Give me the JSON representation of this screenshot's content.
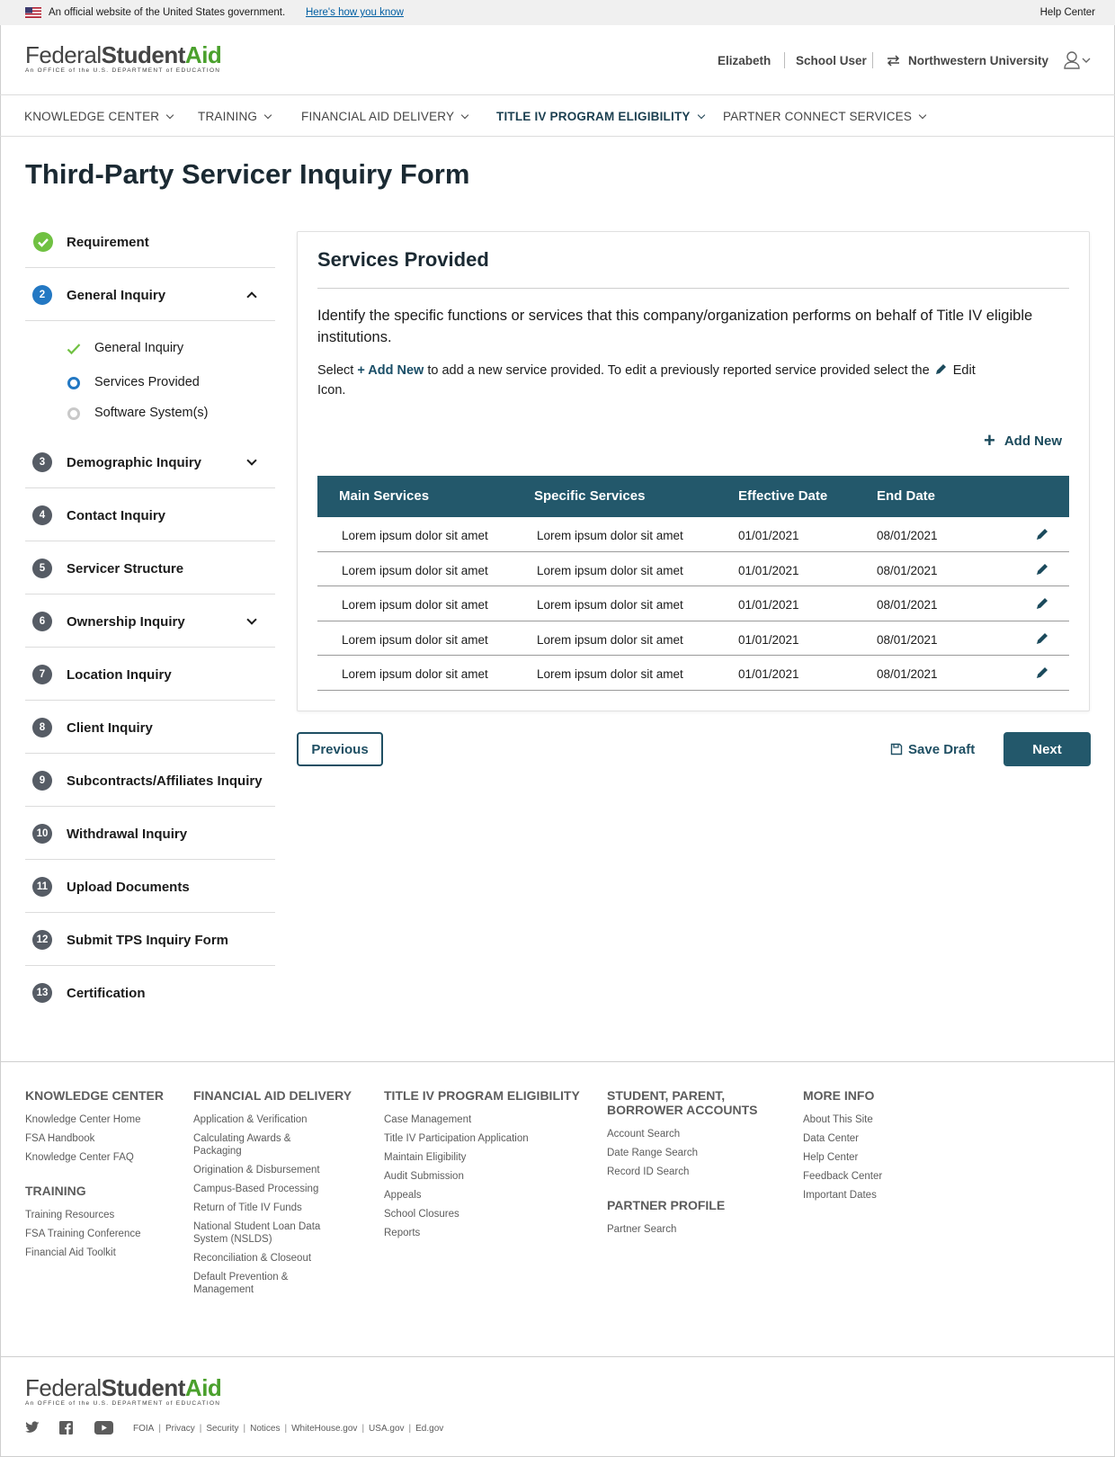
{
  "gov_banner": {
    "official_text": "An official website of the United States government.",
    "how_link": "Here's how you know",
    "help_center": "Help Center"
  },
  "header": {
    "logo": {
      "federal": "Federal",
      "student": "Student",
      "aid": "Aid",
      "tagline": "An OFFICE of the U.S. DEPARTMENT of EDUCATION"
    },
    "user_name": "Elizabeth",
    "role": "School User",
    "institution": "Northwestern University"
  },
  "nav": {
    "items": [
      {
        "label": "KNOWLEDGE CENTER"
      },
      {
        "label": "TRAINING"
      },
      {
        "label": "FINANCIAL AID DELIVERY"
      },
      {
        "label": "TITLE IV PROGRAM ELIGIBILITY"
      },
      {
        "label": "PARTNER CONNECT SERVICES"
      }
    ]
  },
  "page_title": "Third-Party Servicer Inquiry Form",
  "steps": [
    {
      "num": "",
      "label": "Requirement",
      "state": "done"
    },
    {
      "num": "2",
      "label": "General Inquiry",
      "state": "current"
    },
    {
      "num": "3",
      "label": "Demographic Inquiry",
      "state": "todo"
    },
    {
      "num": "4",
      "label": "Contact Inquiry",
      "state": "todo"
    },
    {
      "num": "5",
      "label": "Servicer Structure",
      "state": "todo"
    },
    {
      "num": "6",
      "label": "Ownership Inquiry",
      "state": "todo"
    },
    {
      "num": "7",
      "label": "Location Inquiry",
      "state": "todo"
    },
    {
      "num": "8",
      "label": "Client Inquiry",
      "state": "todo"
    },
    {
      "num": "9",
      "label": "Subcontracts/Affiliates Inquiry",
      "state": "todo"
    },
    {
      "num": "10",
      "label": "Withdrawal Inquiry",
      "state": "todo"
    },
    {
      "num": "11",
      "label": "Upload Documents",
      "state": "todo"
    },
    {
      "num": "12",
      "label": "Submit TPS Inquiry Form",
      "state": "todo"
    },
    {
      "num": "13",
      "label": "Certification",
      "state": "todo"
    }
  ],
  "substeps": [
    {
      "label": "General Inquiry",
      "state": "done"
    },
    {
      "label": "Services Provided",
      "state": "current"
    },
    {
      "label": "Software System(s)",
      "state": "todo"
    }
  ],
  "card": {
    "title": "Services Provided",
    "intro": "Identify the specific functions or services that this company/organization performs on behalf of Title IV eligible institutions.",
    "instr_select": "Select",
    "instr_add": "+ Add New",
    "instr_mid": "to add a new service provided. To edit a previously reported service provided select the",
    "instr_edit": "Edit Icon.",
    "add_new": "Add New"
  },
  "table": {
    "headers": [
      "Main Services",
      "Specific Services",
      "Effective Date",
      "End Date"
    ],
    "rows": [
      [
        "Lorem ipsum dolor sit amet",
        "Lorem ipsum dolor sit amet",
        "01/01/2021",
        "08/01/2021"
      ],
      [
        "Lorem ipsum dolor sit amet",
        "Lorem ipsum dolor sit amet",
        "01/01/2021",
        "08/01/2021"
      ],
      [
        "Lorem ipsum dolor sit amet",
        "Lorem ipsum dolor sit amet",
        "01/01/2021",
        "08/01/2021"
      ],
      [
        "Lorem ipsum dolor sit amet",
        "Lorem ipsum dolor sit amet",
        "01/01/2021",
        "08/01/2021"
      ],
      [
        "Lorem ipsum dolor sit amet",
        "Lorem ipsum dolor sit amet",
        "01/01/2021",
        "08/01/2021"
      ]
    ]
  },
  "actions": {
    "previous": "Previous",
    "save_draft": "Save Draft",
    "next": "Next"
  },
  "footer": {
    "columns": [
      {
        "groups": [
          {
            "heading": "KNOWLEDGE CENTER",
            "links": [
              "Knowledge Center Home",
              "FSA Handbook",
              "Knowledge Center FAQ"
            ]
          },
          {
            "heading": "TRAINING",
            "links": [
              "Training Resources",
              "FSA Training Conference",
              "Financial Aid Toolkit"
            ]
          }
        ]
      },
      {
        "groups": [
          {
            "heading": "FINANCIAL AID DELIVERY",
            "links": [
              "Application & Verification",
              "Calculating Awards & Packaging",
              "Origination & Disbursement",
              "Campus-Based Processing",
              "Return of Title IV Funds",
              "National Student Loan Data System (NSLDS)",
              "Reconciliation & Closeout",
              "Default Prevention & Management"
            ]
          }
        ]
      },
      {
        "groups": [
          {
            "heading": "TITLE IV PROGRAM ELIGIBILITY",
            "links": [
              "Case Management",
              "Title IV Participation Application",
              "Maintain Eligibility",
              "Audit Submission",
              "Appeals",
              "School Closures",
              "Reports"
            ]
          }
        ]
      },
      {
        "groups": [
          {
            "heading": "STUDENT, PARENT, BORROWER ACCOUNTS",
            "links": [
              "Account Search",
              "Date Range Search",
              "Record ID Search"
            ]
          },
          {
            "heading": "PARTNER PROFILE",
            "links": [
              "Partner Search"
            ]
          }
        ]
      },
      {
        "groups": [
          {
            "heading": "MORE INFO",
            "links": [
              "About This Site",
              "Data Center",
              "Help Center",
              "Feedback Center",
              "Important Dates"
            ]
          }
        ]
      }
    ],
    "legal": [
      "FOIA",
      "Privacy",
      "Security",
      "Notices",
      "WhiteHouse.gov",
      "USA.gov",
      "Ed.gov"
    ],
    "social_icons": [
      "twitter-icon",
      "facebook-icon",
      "youtube-icon"
    ]
  },
  "colors": {
    "primary": "#23586b",
    "accent_green": "#4aa02c",
    "current_blue": "#2378c3",
    "done_green": "#70c142"
  }
}
